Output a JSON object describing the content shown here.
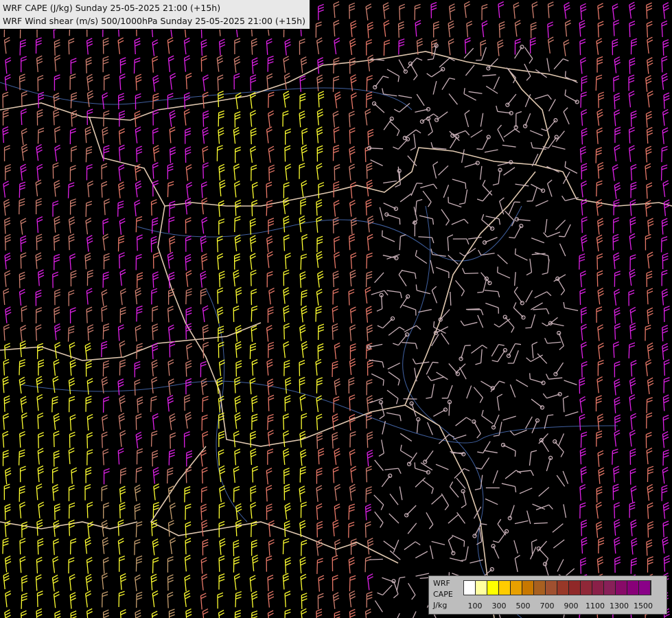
{
  "title": {
    "line1": "WRF CAPE (J/kg) Sunday 25-05-2025 21:00 (+15h)",
    "line2": "WRF Wind shear (m/s) 500/1000hPa Sunday 25-05-2025 21:00 (+15h)"
  },
  "legend": {
    "label1": "WRF",
    "label2": "CAPE",
    "label3": "J/kg",
    "tick_labels": [
      "100",
      "300",
      "500",
      "700",
      "900",
      "1100",
      "1300",
      "1500"
    ],
    "colors": [
      "#ffffff",
      "#ffffa0",
      "#ffff00",
      "#ffcc00",
      "#e8a000",
      "#c87800",
      "#a86020",
      "#a05030",
      "#983828",
      "#902828",
      "#902838",
      "#8a2048",
      "#882058",
      "#880a68",
      "#880078",
      "#8a0088"
    ]
  },
  "map": {
    "background": "#000000",
    "barb_colors": {
      "weak": "#c8b0b8",
      "moderate": "#d08070",
      "salmon": "#e87868",
      "yellow": "#ffff30",
      "magenta": "#e020e8",
      "pink": "#c060c0",
      "tan": "#c8a070"
    },
    "border_color": "#e0c8b0",
    "river_color": "#4060a0"
  }
}
